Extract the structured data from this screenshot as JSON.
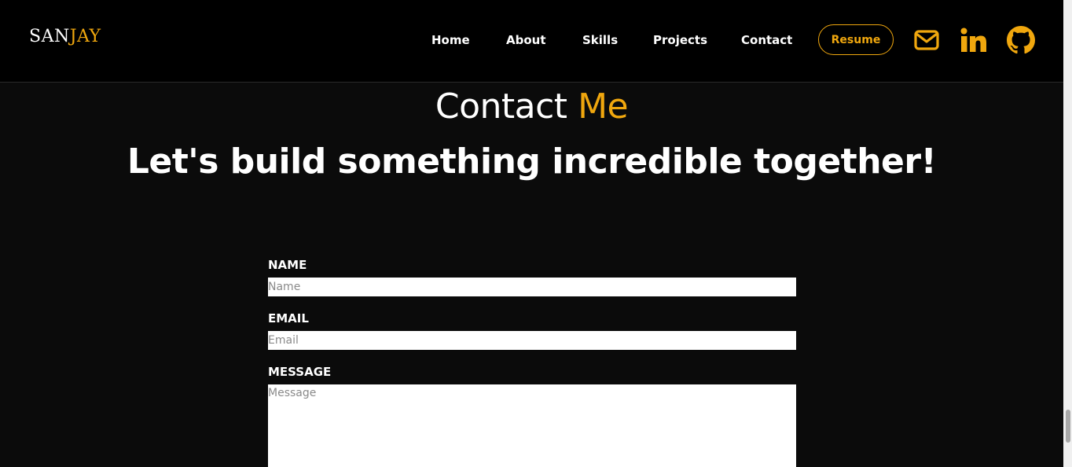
{
  "brand": {
    "first": "SAN",
    "second": "JAY"
  },
  "nav": {
    "links": [
      "Home",
      "About",
      "Skills",
      "Projects",
      "Contact"
    ],
    "resume_label": "Resume"
  },
  "social": {
    "icons": [
      "mail-icon",
      "linkedin-icon",
      "github-icon"
    ]
  },
  "contact": {
    "title_main": "Contact",
    "title_accent": "Me",
    "tagline": "Let's build something incredible together!",
    "fields": {
      "name": {
        "label": "NAME",
        "placeholder": "Name",
        "value": ""
      },
      "email": {
        "label": "EMAIL",
        "placeholder": "Email",
        "value": ""
      },
      "message": {
        "label": "MESSAGE",
        "placeholder": "Message",
        "value": ""
      }
    }
  },
  "colors": {
    "accent": "#f0a70e",
    "nav_bg": "#000000",
    "page_bg": "#0b0b0b",
    "text": "#ffffff"
  }
}
